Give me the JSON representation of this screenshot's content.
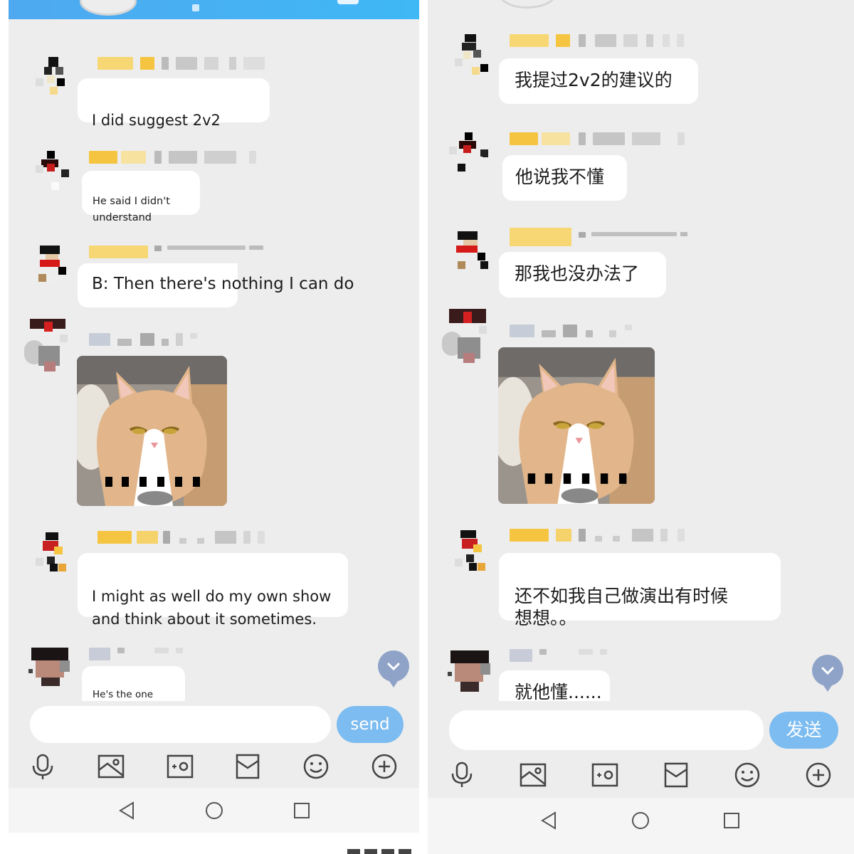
{
  "left": {
    "messages": [
      {
        "text": "I did suggest 2v2"
      },
      {
        "text": "He said I didn't\nunderstand"
      },
      {
        "text": "B: Then there's nothing I can do"
      },
      {
        "image": "cat-sticker"
      },
      {
        "text": "I might as well do my own show\nand think about it sometimes."
      },
      {
        "text": "He's the one who\nknows... ..."
      }
    ],
    "send_label": "send",
    "input_value": ""
  },
  "right": {
    "messages": [
      {
        "text": "我提过2v2的建议的"
      },
      {
        "text": "他说我不懂"
      },
      {
        "text": "那我也没办法了"
      },
      {
        "image": "cat-sticker"
      },
      {
        "text": "还不如我自己做演出有时候\n想想。。"
      },
      {
        "text": "就他懂......"
      }
    ],
    "send_label": "发送",
    "input_value": ""
  },
  "toolbar_icons": [
    "microphone-icon",
    "picture-icon",
    "camera-icon",
    "red-packet-icon",
    "emoji-icon",
    "plus-icon"
  ],
  "nav_icons": [
    "back-icon",
    "home-icon",
    "recents-icon"
  ],
  "colors": {
    "header": "#4fa9f0",
    "chat_background": "#ededed",
    "bubble": "#ffffff",
    "send_button": "#7cbcf0",
    "scroll_button": "#8fa3c8",
    "name_highlight": "#f5c542"
  }
}
